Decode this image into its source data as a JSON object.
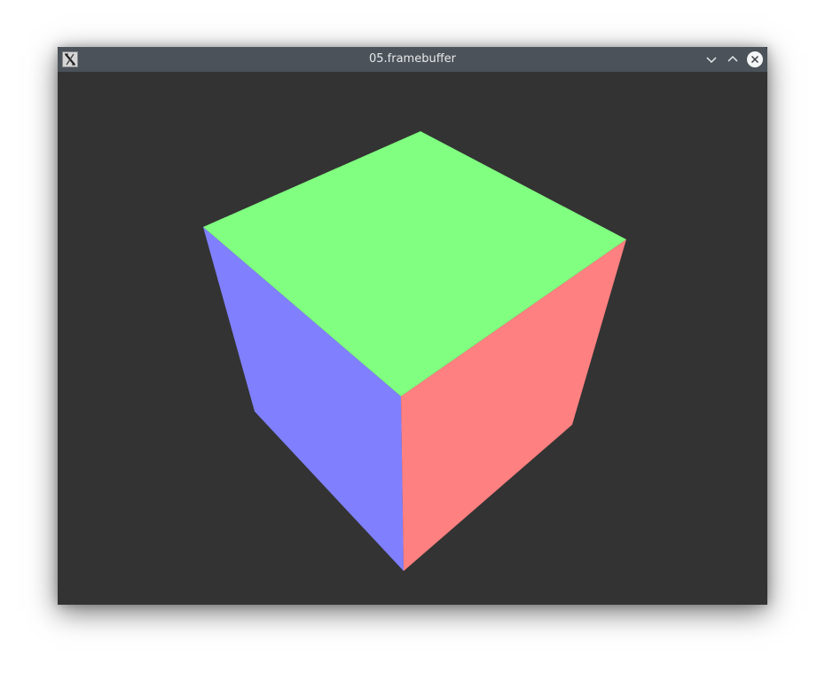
{
  "window": {
    "title": "05.framebuffer",
    "buttons": {
      "minimize": "chevron-down-icon",
      "maximize": "chevron-up-icon",
      "close": "close-icon"
    }
  },
  "scene": {
    "background_color": "#333333",
    "cube": {
      "top_face_color": "#80ff80",
      "left_face_color": "#8080ff",
      "right_face_color": "#ff8080"
    }
  }
}
